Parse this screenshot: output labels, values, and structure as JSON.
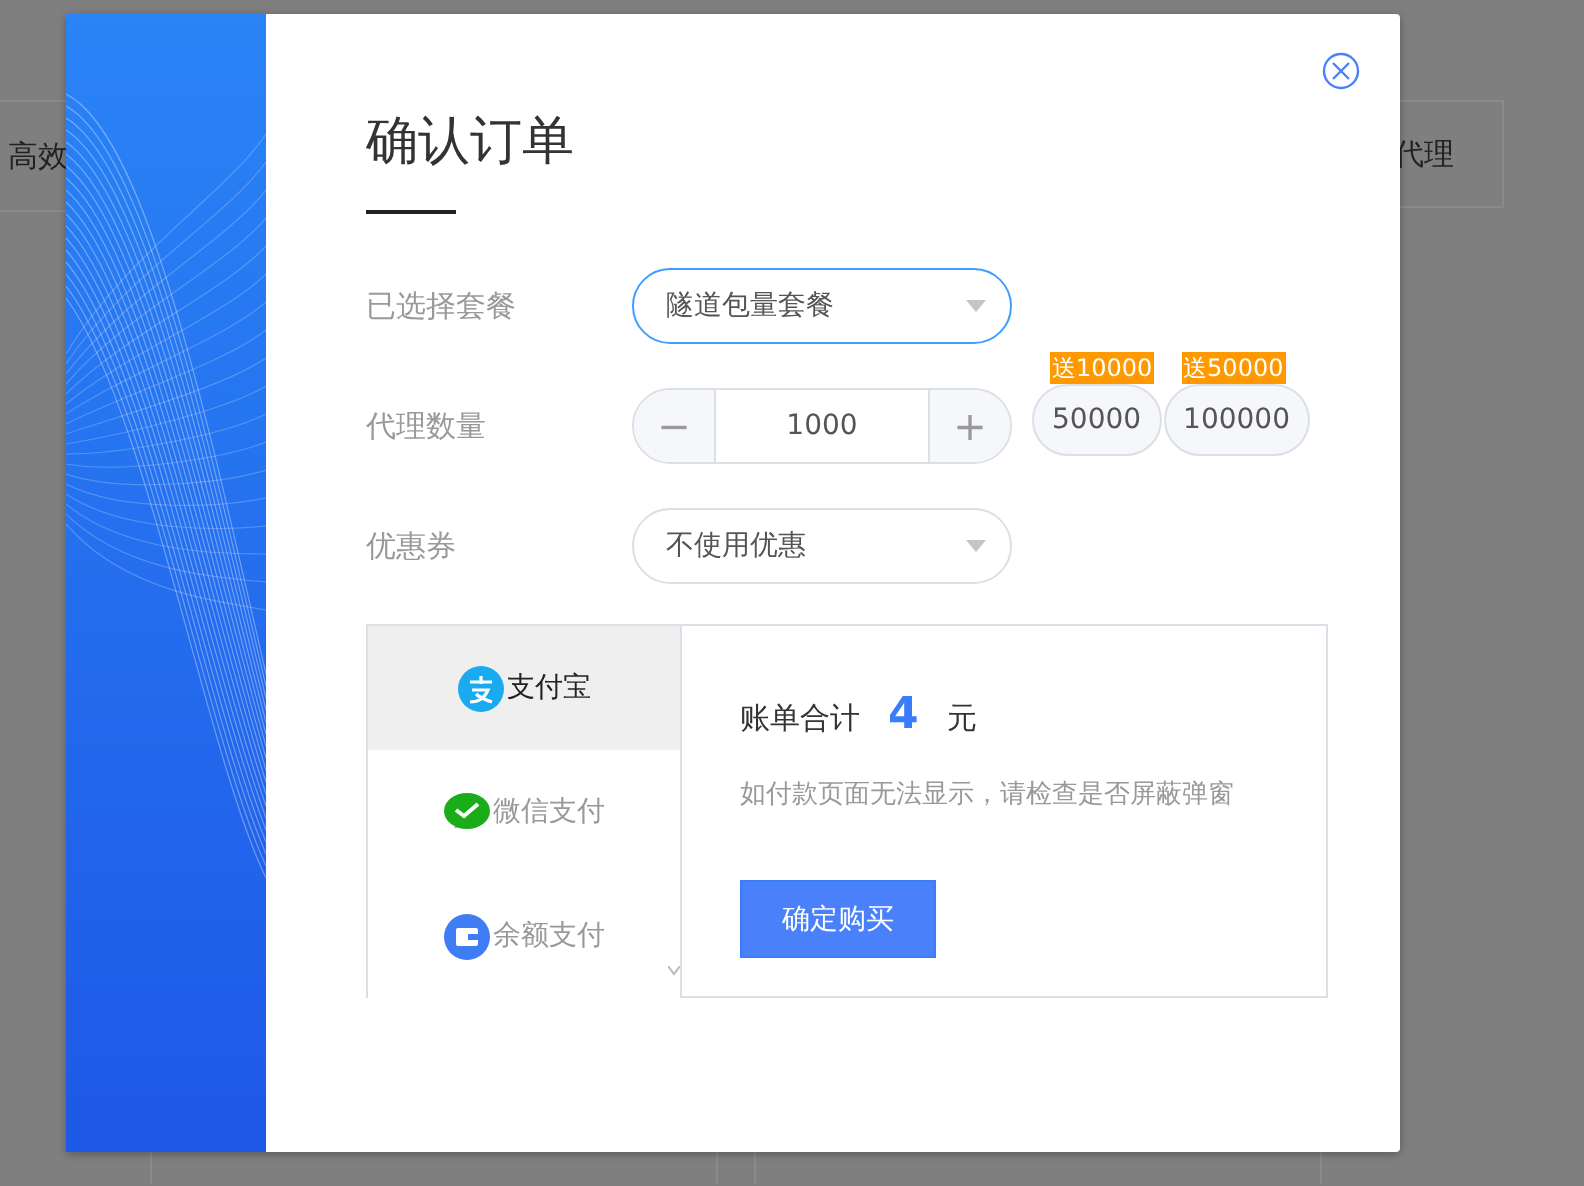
{
  "background": {
    "texts": [
      "高效",
      "代理"
    ]
  },
  "dialog": {
    "title": "确认订单",
    "fields": [
      {
        "kind": "select",
        "label": "已选择套餐",
        "value": "隧道包量套餐",
        "focused": true
      },
      {
        "kind": "stepper",
        "label": "代理数量",
        "value": "1000",
        "decrement": "−",
        "increment": "+",
        "presets": [
          {
            "badge": "送10000",
            "value": "50000"
          },
          {
            "badge": "送50000",
            "value": "100000"
          }
        ]
      },
      {
        "kind": "select",
        "label": "优惠券",
        "value": "不使用优惠",
        "focused": false
      }
    ],
    "payment": {
      "methods": [
        {
          "kind": "alipay",
          "label": "支付宝",
          "selected": true
        },
        {
          "kind": "wechat",
          "label": "微信支付",
          "selected": false
        },
        {
          "kind": "wallet",
          "label": "余额支付",
          "selected": false
        }
      ],
      "total_label": "账单合计",
      "total": "4",
      "unit": "元",
      "note": "如付款页面无法显示，请检查是否屏蔽弹窗",
      "button": "确定购买"
    }
  }
}
